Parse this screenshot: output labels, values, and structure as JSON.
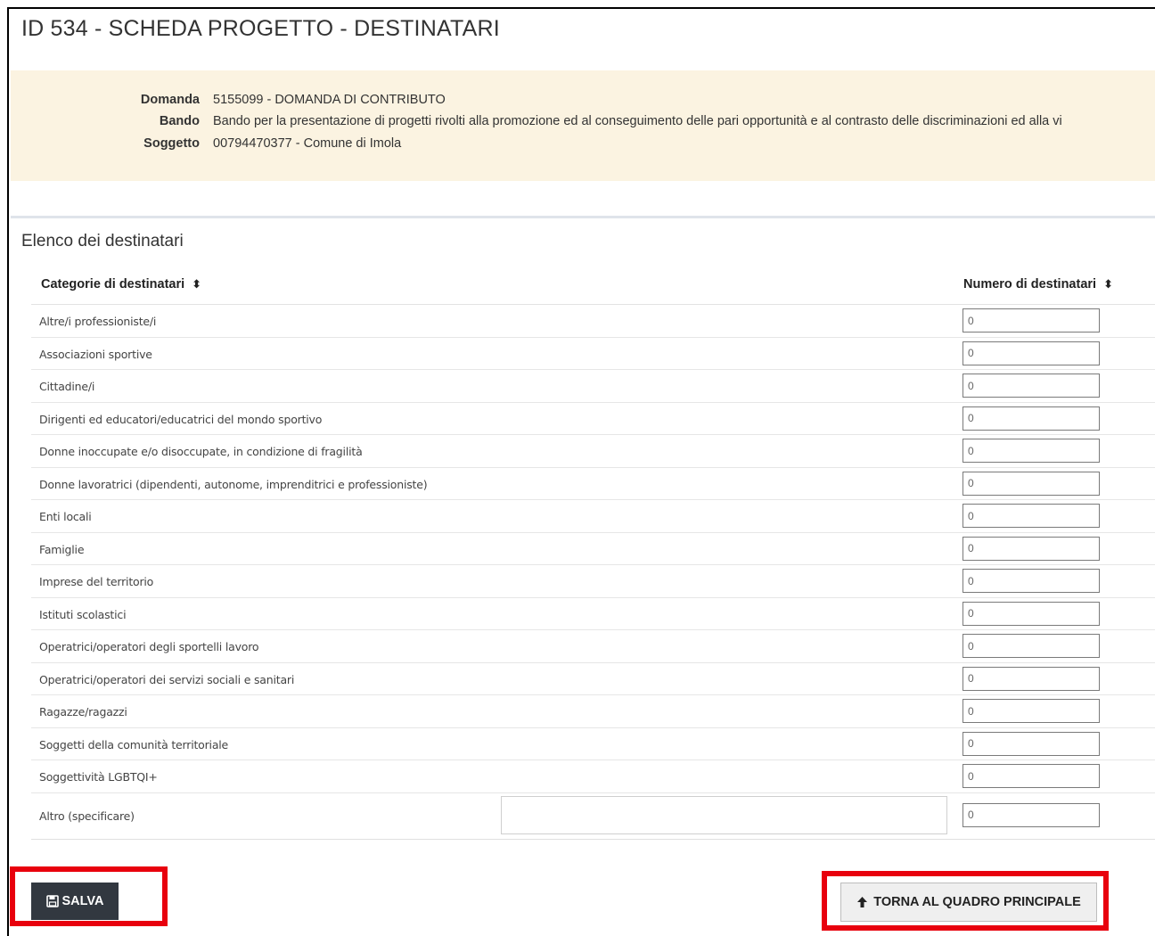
{
  "page": {
    "title": "ID 534 - SCHEDA PROGETTO - DESTINATARI"
  },
  "info": {
    "domanda_label": "Domanda",
    "domanda_value": "5155099 - DOMANDA DI CONTRIBUTO",
    "bando_label": "Bando",
    "bando_value": "Bando per la presentazione di progetti rivolti alla promozione ed al conseguimento delle pari opportunità e al contrasto delle discriminazioni ed alla vi",
    "soggetto_label": "Soggetto",
    "soggetto_value": "00794470377 - Comune di Imola"
  },
  "section": {
    "title": "Elenco dei destinatari"
  },
  "table": {
    "col_category": "Categorie di destinatari",
    "col_number": "Numero di destinatari",
    "sort_icon": "sort-icon",
    "rows": [
      {
        "label": "Altre/i professioniste/i",
        "value": "0"
      },
      {
        "label": "Associazioni sportive",
        "value": "0"
      },
      {
        "label": "Cittadine/i",
        "value": "0"
      },
      {
        "label": "Dirigenti ed educatori/educatrici del mondo sportivo",
        "value": "0"
      },
      {
        "label": "Donne inoccupate e/o disoccupate, in condizione di fragilità",
        "value": "0"
      },
      {
        "label": "Donne lavoratrici (dipendenti, autonome, imprenditrici e professioniste)",
        "value": "0"
      },
      {
        "label": "Enti locali",
        "value": "0"
      },
      {
        "label": "Famiglie",
        "value": "0"
      },
      {
        "label": "Imprese del territorio",
        "value": "0"
      },
      {
        "label": "Istituti scolastici",
        "value": "0"
      },
      {
        "label": "Operatrici/operatori degli sportelli lavoro",
        "value": "0"
      },
      {
        "label": "Operatrici/operatori dei servizi sociali e sanitari",
        "value": "0"
      },
      {
        "label": "Ragazze/ragazzi",
        "value": "0"
      },
      {
        "label": "Soggetti della comunità territoriale",
        "value": "0"
      },
      {
        "label": "Soggettività LGBTQI+",
        "value": "0"
      }
    ],
    "other": {
      "label": "Altro (specificare)",
      "text_value": "",
      "value": "0"
    }
  },
  "actions": {
    "save_label": "SALVA",
    "save_icon": "floppy-disk-icon",
    "back_label": "TORNA AL QUADRO PRINCIPALE",
    "back_icon": "arrow-up-icon"
  },
  "colors": {
    "info_background": "#fbf3e1",
    "save_button": "#323840",
    "highlight": "#e8000d"
  }
}
